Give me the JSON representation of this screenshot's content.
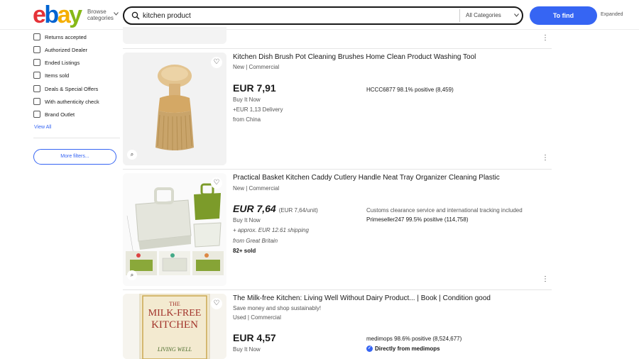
{
  "header": {
    "logo": [
      "e",
      "b",
      "a",
      "y"
    ],
    "logo_colors": [
      "#e53238",
      "#0064d2",
      "#f5af02",
      "#86b817"
    ],
    "browse_line1": "Browse",
    "browse_line2": "categories",
    "search_value": "kitchen product",
    "category": "All Categories",
    "find_label": "To find",
    "expanded_label": "Expanded"
  },
  "sidebar": {
    "filters": [
      "Returns accepted",
      "Authorized Dealer",
      "Ended Listings",
      "Items sold",
      "Deals & Special Offers",
      "With authenticity check",
      "Brand Outlet"
    ],
    "view_all": "View All",
    "more_filters": "More filters..."
  },
  "listings": [
    {
      "title": "Kitchen Dish Brush Pot Cleaning Brushes Home Clean Product Washing Tool",
      "condition": "New | Commercial",
      "price": "EUR 7,91",
      "buy": "Buy It Now",
      "delivery": "+EUR 1,13 Delivery",
      "origin": "from China",
      "seller": "HCCC6877 98.1% positive (8,459)"
    },
    {
      "title": "Practical Basket Kitchen Caddy Cutlery Handle Neat Tray Organizer Cleaning Plastic",
      "condition": "New | Commercial",
      "price": "EUR 7,64",
      "unit_price": "(EUR 7,64/unit)",
      "buy": "Buy It Now",
      "delivery": "+ approx. EUR 12.61 shipping",
      "origin": "from Great Britain",
      "sold": "82+ sold",
      "note": "Customs clearance service and international tracking included",
      "seller": "Primeseller247 99.5% positive (114,758)"
    },
    {
      "title": "The Milk-free Kitchen: Living Well Without Dairy Product... | Book | Condition good",
      "subtitle": "Save money and shop sustainably!",
      "condition": "Used | Commercial",
      "price": "EUR 4,57",
      "buy": "Buy It Now",
      "seller": "medimops 98.6% positive (8,524,677)",
      "direct": "Directly from medimops",
      "book_cover": [
        "THE",
        "MILK-FREE",
        "KITCHEN",
        "LIVING WELL"
      ]
    }
  ],
  "icons": {
    "more": "⋮",
    "heart": "♡",
    "search": "search-icon",
    "visual_search": "⌕"
  }
}
